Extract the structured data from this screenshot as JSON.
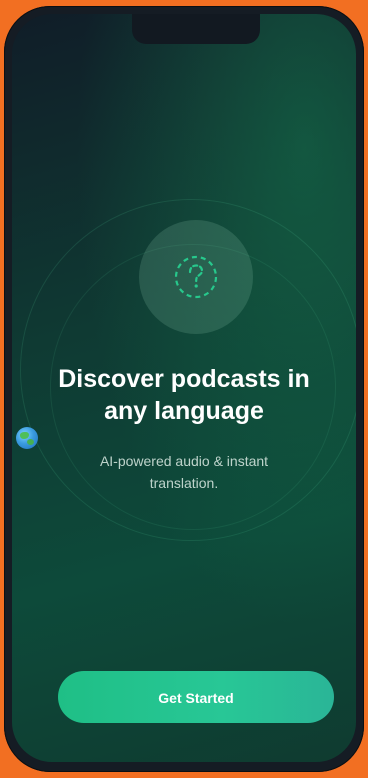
{
  "onboarding": {
    "headline_line1": "Discover podcasts in",
    "headline_line2": "any language",
    "headline_emoji_icon": "globe-icon",
    "subtitle_line1": "AI-powered audio & instant",
    "subtitle_line2": "translation.",
    "cta_label": "Get Started",
    "logo_icon": "question-mark-icon"
  },
  "colors": {
    "frame_background": "#f26f22",
    "accent": "#1fbf86",
    "screen_dark": "#101d28",
    "screen_green": "#0d4a3a"
  }
}
